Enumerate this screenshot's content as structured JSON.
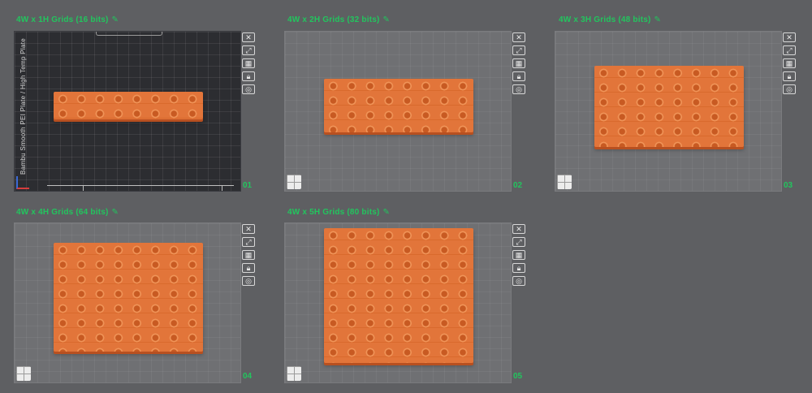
{
  "colors": {
    "title_green": "#22c55e",
    "accent_orange": "#e2753a"
  },
  "plates": [
    {
      "title": "4W x 1H Grids (16 bits)",
      "number": "01",
      "active": true,
      "plate_type_label": "Bambu Smooth PEI Plate / High Temp Plate",
      "grid_rows": 1
    },
    {
      "title": "4W x 2H Grids (32 bits)",
      "number": "02",
      "active": false,
      "grid_rows": 2
    },
    {
      "title": "4W x 3H Grids (48 bits)",
      "number": "03",
      "active": false,
      "grid_rows": 3
    },
    {
      "title": "4W x 4H Grids (64 bits)",
      "number": "04",
      "active": false,
      "grid_rows": 4
    },
    {
      "title": "4W x 5H Grids (80 bits)",
      "number": "05",
      "active": false,
      "grid_rows": 5
    }
  ],
  "toolbar_icons": [
    "close-icon",
    "auto-orient-icon",
    "arrange-icon",
    "lock-icon",
    "settings-icon"
  ]
}
